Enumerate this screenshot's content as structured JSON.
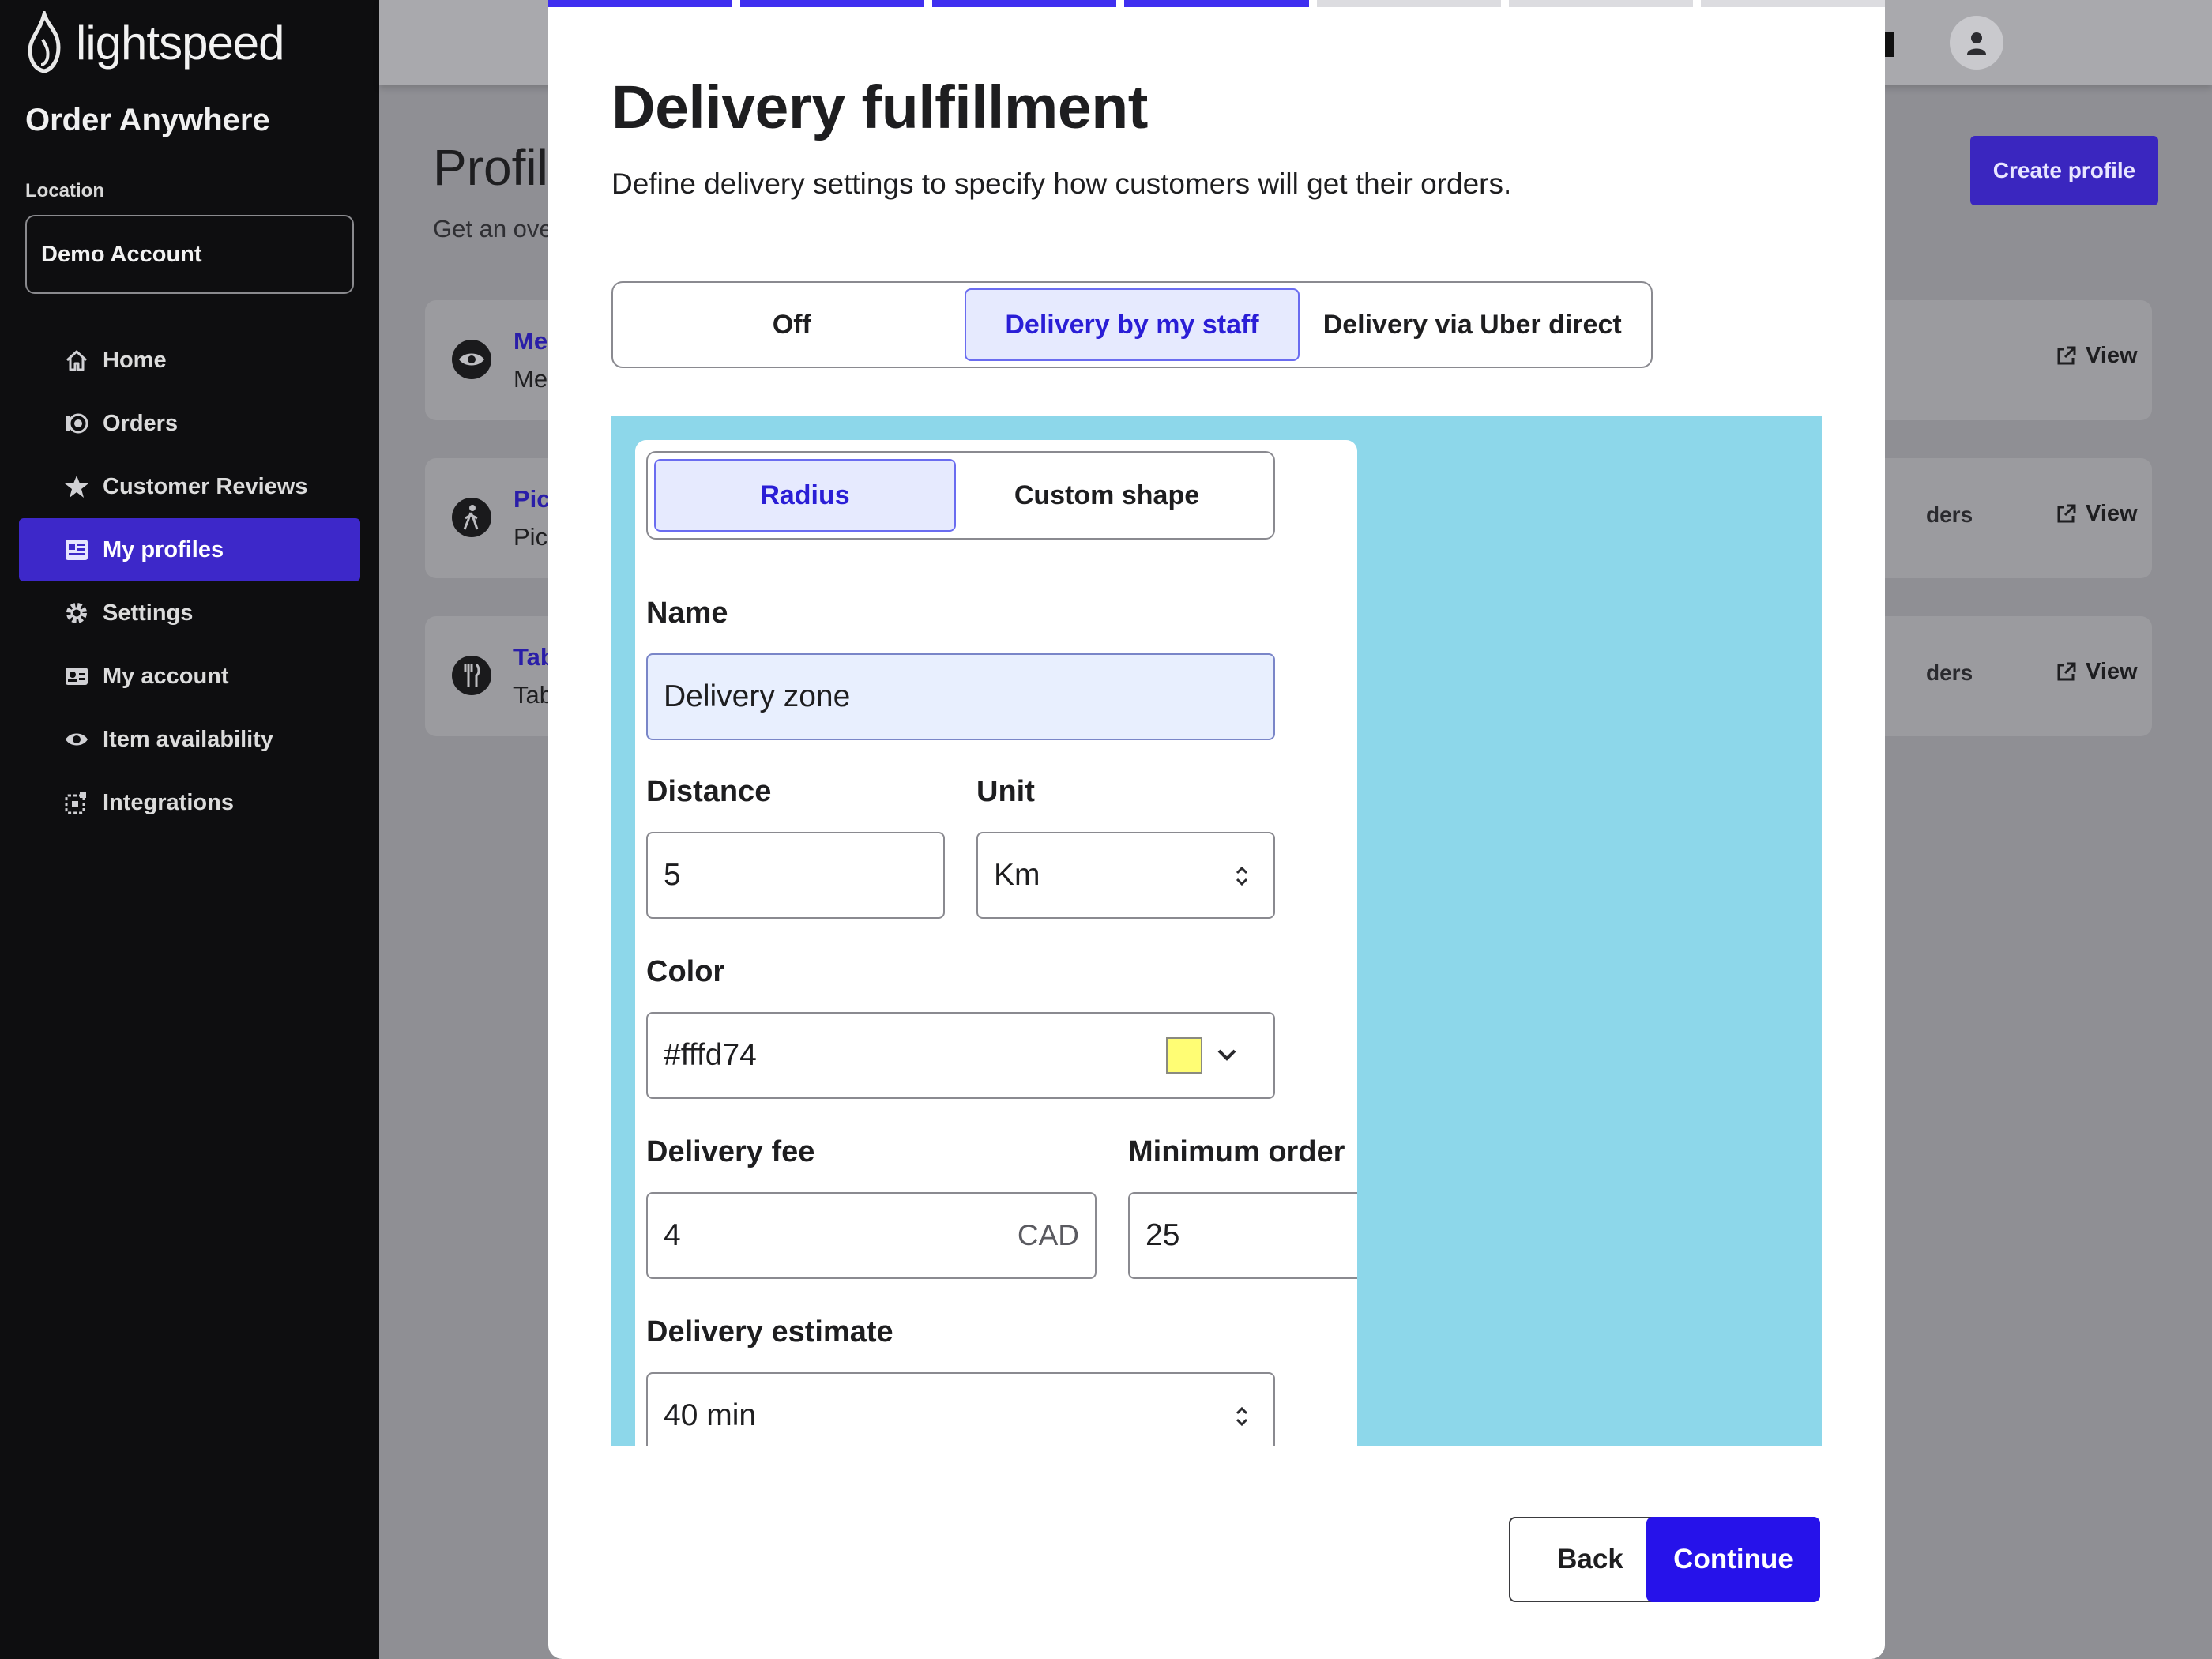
{
  "brand": {
    "name": "lightspeed",
    "app_title": "Order Anywhere"
  },
  "location": {
    "label": "Location",
    "value": "Demo Account"
  },
  "sidebar": {
    "items": [
      {
        "label": "Home",
        "icon": "home-icon",
        "active": false
      },
      {
        "label": "Orders",
        "icon": "orders-icon",
        "active": false
      },
      {
        "label": "Customer Reviews",
        "icon": "star-icon",
        "active": false
      },
      {
        "label": "My profiles",
        "icon": "profiles-icon",
        "active": true
      },
      {
        "label": "Settings",
        "icon": "gear-icon",
        "active": false
      },
      {
        "label": "My account",
        "icon": "account-card-icon",
        "active": false
      },
      {
        "label": "Item availability",
        "icon": "eye-icon",
        "active": false
      },
      {
        "label": "Integrations",
        "icon": "integrations-icon",
        "active": false
      }
    ]
  },
  "background_page": {
    "title": "Profil",
    "subtitle": "Get an ove",
    "create_button": "Create profile",
    "cards": [
      {
        "icon": "eye-icon",
        "title": "Me",
        "subtitle": "Me",
        "side": "",
        "view": "View"
      },
      {
        "icon": "walking-icon",
        "title": "Pic",
        "subtitle": "Pic",
        "side": "ders",
        "view": "View"
      },
      {
        "icon": "utensils-icon",
        "title": "Tab",
        "subtitle": "Tab",
        "side": "ders",
        "view": "View"
      }
    ]
  },
  "modal": {
    "steps_total": 7,
    "steps_completed": 4,
    "title": "Delivery fulfillment",
    "subtitle": "Define delivery settings to specify how customers will get their orders.",
    "fulfillment_options": [
      "Off",
      "Delivery by my staff",
      "Delivery via Uber direct"
    ],
    "fulfillment_selected": "Delivery by my staff",
    "zone": {
      "shape_options": [
        "Radius",
        "Custom shape"
      ],
      "shape_selected": "Radius",
      "name_label": "Name",
      "name_value": "Delivery zone",
      "distance_label": "Distance",
      "distance_value": "5",
      "unit_label": "Unit",
      "unit_value": "Km",
      "color_label": "Color",
      "color_value": "#fffd74",
      "fee_label": "Delivery fee",
      "fee_value": "4",
      "fee_currency": "CAD",
      "min_order_label": "Minimum order",
      "min_order_value": "25",
      "estimate_label": "Delivery estimate",
      "estimate_value": "40 min"
    },
    "back_button": "Back",
    "continue_button": "Continue"
  },
  "colors": {
    "accent": "#2612ea",
    "sidebar_bg": "#0e0e10",
    "map_water": "#8dd7ea",
    "zone_color": "#fffd74"
  }
}
